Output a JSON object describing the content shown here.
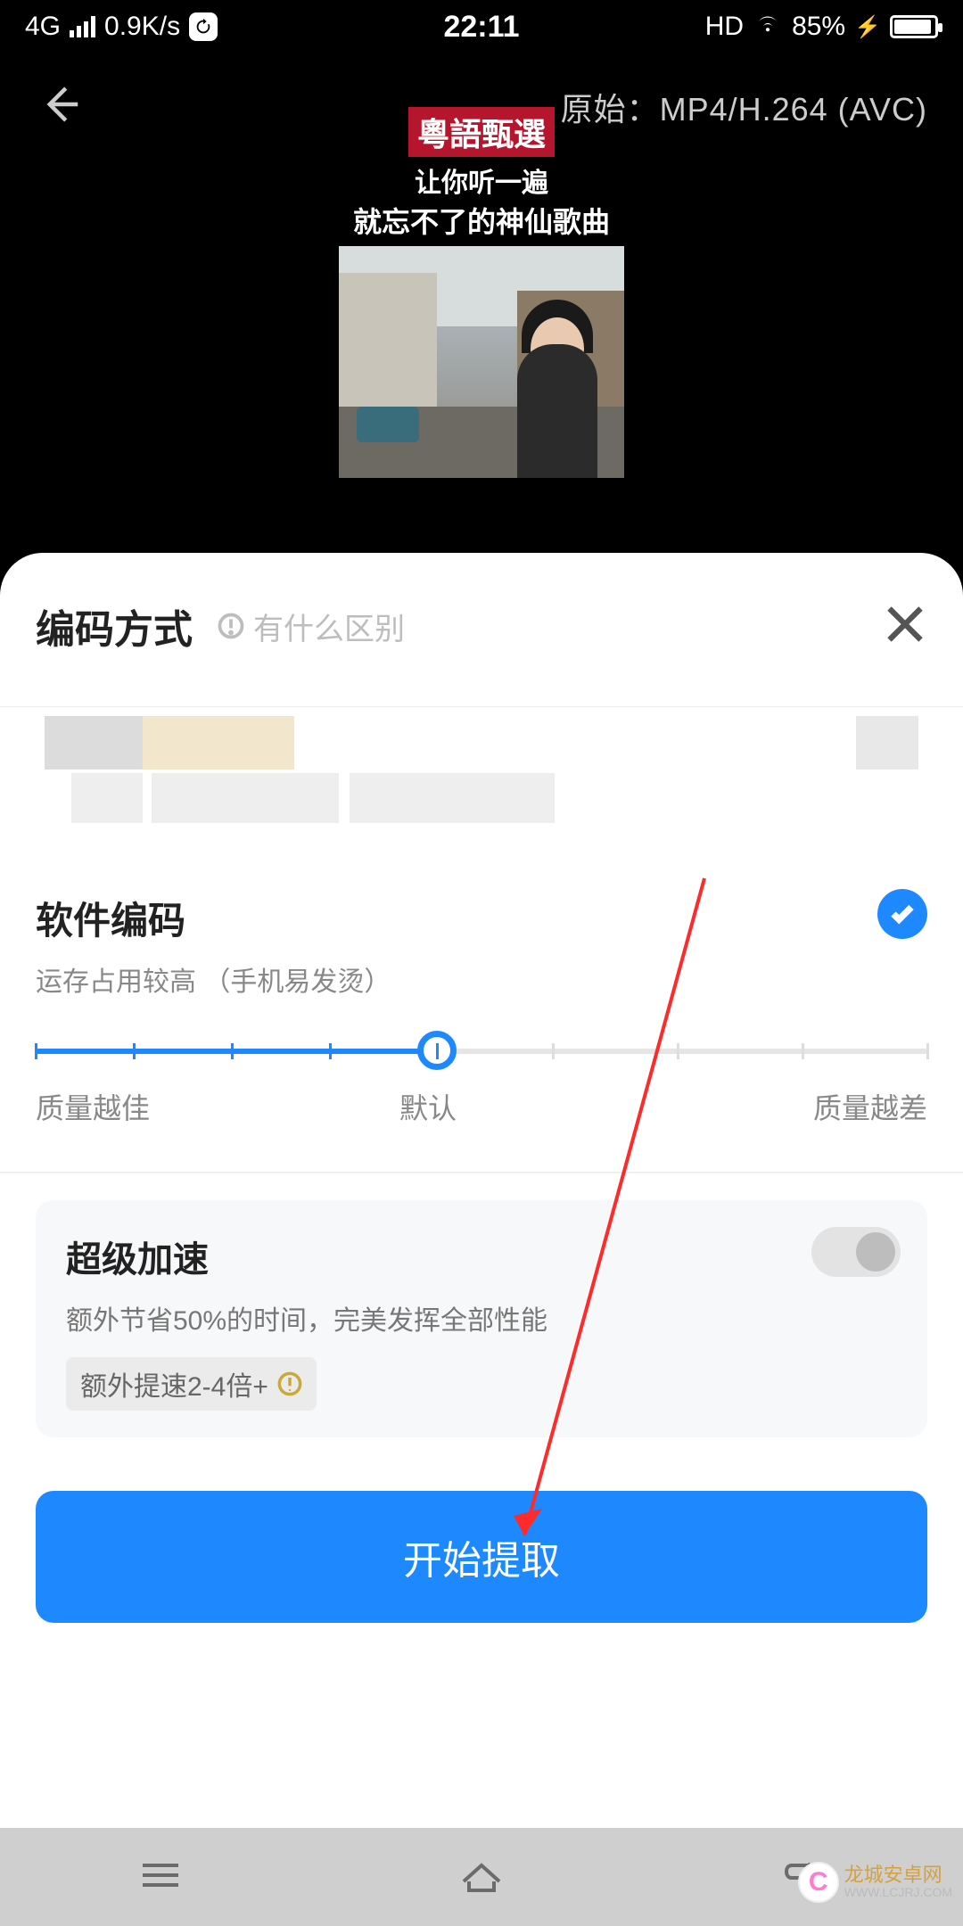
{
  "status": {
    "net_type": "4G",
    "speed": "0.9K/s",
    "time": "22:11",
    "hd": "HD",
    "battery_pct": "85%",
    "battery_fill_pct": 85
  },
  "preview": {
    "format_label": "原始：MP4/H.264 (AVC)",
    "thumb_title": "粵語甄選",
    "thumb_line1": "让你听一遍",
    "thumb_line2": "就忘不了的神仙歌曲"
  },
  "sheet": {
    "title": "编码方式",
    "help_text": "有什么区别"
  },
  "option": {
    "title": "软件编码",
    "subtitle": "运存占用较高 （手机易发烫）",
    "selected": true
  },
  "slider": {
    "left_label": "质量越佳",
    "mid_label": "默认",
    "right_label": "质量越差",
    "fill_pct": 45,
    "ticks_pct": [
      0,
      11,
      22,
      33,
      45,
      58,
      72,
      86,
      100
    ],
    "filled_until_idx": 4
  },
  "boost": {
    "title": "超级加速",
    "subtitle": "额外节省50%的时间，完美发挥全部性能",
    "tag": "额外提速2-4倍+",
    "enabled": false
  },
  "cta": "开始提取",
  "watermark": {
    "c": "C",
    "name": "龙城安卓网",
    "sub": "WWW.LCJRJ.COM"
  }
}
